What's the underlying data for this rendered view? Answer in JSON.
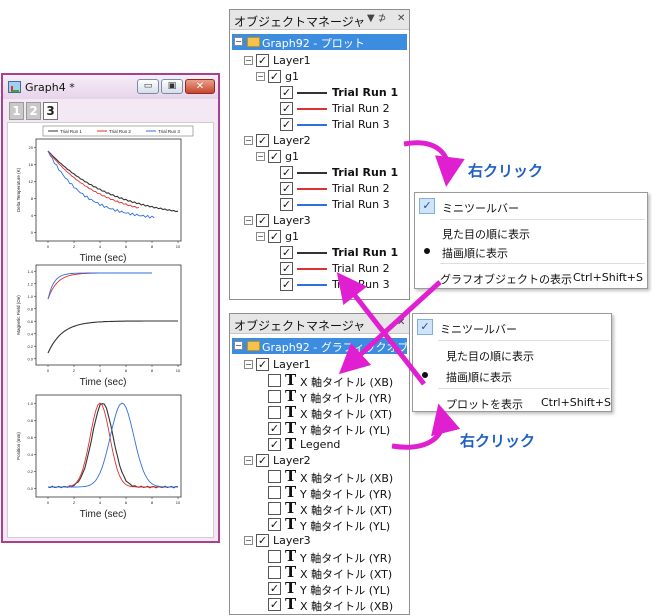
{
  "graph_window": {
    "title": "Graph4 *",
    "layer_tabs": [
      "1",
      "2",
      "3"
    ],
    "legend": [
      "Trial Run 1",
      "Trial Run 2",
      "Trial Run 3"
    ],
    "series_colors": [
      "#333333",
      "#e03030",
      "#2f6fe0"
    ],
    "xlabel": "Time (sec)",
    "ylabel_top": "Delta Temperature (K)",
    "ylabel_mid": "Magnetic Field (Oe)",
    "ylabel_bot": "Position (mm)",
    "x_ticks": [
      "0",
      "2",
      "4",
      "6",
      "8",
      "10"
    ],
    "y_ticks_top": [
      "0",
      "4",
      "8",
      "12",
      "16",
      "20"
    ],
    "y_ticks_mid": [
      "0.0",
      "0.2",
      "0.4",
      "0.6",
      "0.8",
      "1.0",
      "1.2",
      "1.4"
    ],
    "y_ticks_bot": [
      "0.0",
      "0.2",
      "0.4",
      "0.6",
      "0.8",
      "1.0"
    ]
  },
  "om_top": {
    "title": "オブジェクトマネージャ",
    "pin": "▼ ⊅",
    "close": "✕",
    "root": "Graph92 - プロット",
    "layers": [
      {
        "name": "Layer1",
        "group": "g1",
        "plots": [
          "Trial Run 1",
          "Trial Run 2",
          "Trial Run 3"
        ]
      },
      {
        "name": "Layer2",
        "group": "g1",
        "plots": [
          "Trial Run 1",
          "Trial Run 2",
          "Trial Run 3"
        ]
      },
      {
        "name": "Layer3",
        "group": "g1",
        "plots": [
          "Trial Run 1",
          "Trial Run 2",
          "Trial Run 3"
        ]
      }
    ]
  },
  "menu_top": {
    "items": [
      {
        "label": "ミニツールバー",
        "mark": "check"
      },
      {
        "label": "見た目の順に表示",
        "mark": ""
      },
      {
        "label": "描画順に表示",
        "mark": "dot"
      },
      {
        "label": "グラフオブジェクトの表示",
        "shortcut": "Ctrl+Shift+S"
      }
    ]
  },
  "om_bottom": {
    "title": "オブジェクトマネージャ",
    "root": "Graph92 - グラフィックオブジェクト",
    "layers": [
      {
        "name": "Layer1",
        "items": [
          {
            "label": "X 軸タイトル (XB)",
            "checked": false
          },
          {
            "label": "Y 軸タイトル (YR)",
            "checked": false
          },
          {
            "label": "X 軸タイトル (XT)",
            "checked": false
          },
          {
            "label": "Y 軸タイトル (YL)",
            "checked": true
          },
          {
            "label": "Legend",
            "checked": true
          }
        ]
      },
      {
        "name": "Layer2",
        "items": [
          {
            "label": "X 軸タイトル (XB)",
            "checked": false
          },
          {
            "label": "Y 軸タイトル (YR)",
            "checked": false
          },
          {
            "label": "X 軸タイトル (XT)",
            "checked": false
          },
          {
            "label": "Y 軸タイトル (YL)",
            "checked": true
          }
        ]
      },
      {
        "name": "Layer3",
        "items": [
          {
            "label": "Y 軸タイトル (YR)",
            "checked": false
          },
          {
            "label": "X 軸タイトル (XT)",
            "checked": false
          },
          {
            "label": "Y 軸タイトル (YL)",
            "checked": true
          },
          {
            "label": "X 軸タイトル (XB)",
            "checked": true
          }
        ]
      }
    ]
  },
  "menu_bottom": {
    "items": [
      {
        "label": "ミニツールバー",
        "mark": "check"
      },
      {
        "label": "見た目の順に表示",
        "mark": ""
      },
      {
        "label": "描画順に表示",
        "mark": "dot"
      },
      {
        "label": "プロットを表示",
        "shortcut": "Ctrl+Shift+S"
      }
    ]
  },
  "annotations": {
    "right_click_1": "右クリック",
    "right_click_2": "右クリック",
    "arrow_color": "#e020d0",
    "label_color": "#1f5fc4"
  }
}
